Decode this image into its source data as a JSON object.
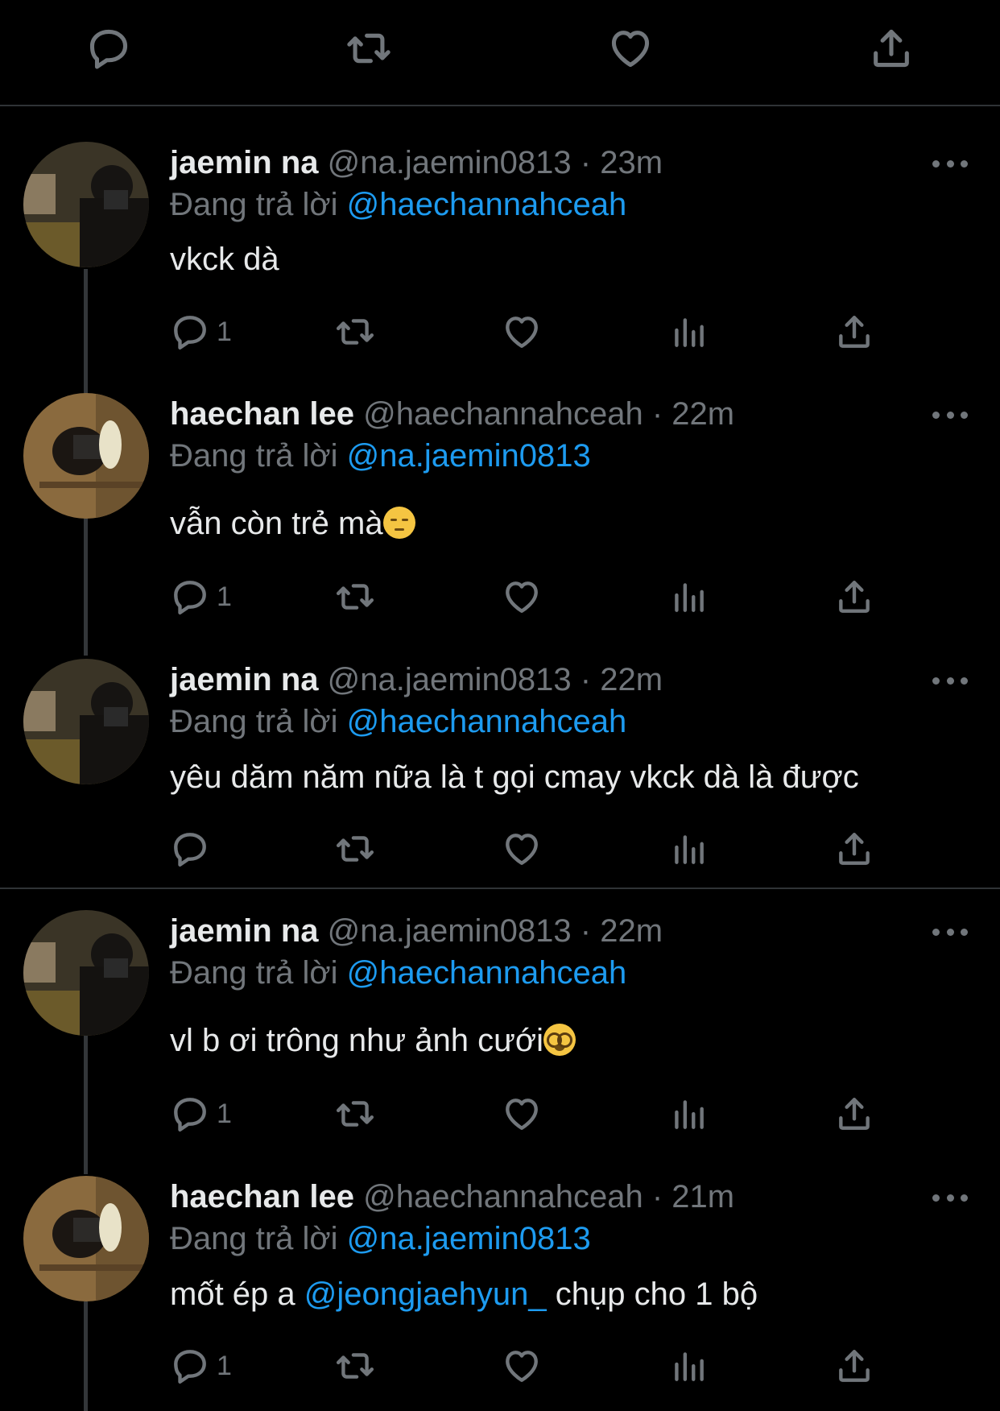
{
  "colors": {
    "background": "#000000",
    "text": "#e7e9ea",
    "muted": "#71767b",
    "accent": "#1d9bf0",
    "divider": "#2f3336"
  },
  "top_actions": [
    "reply-icon",
    "retweet-icon",
    "like-icon",
    "share-icon"
  ],
  "tweets": [
    {
      "name": "jaemin na",
      "handle": "@na.jaemin0813",
      "time": "· 23m",
      "replying_label": "Đang trả lời",
      "replying_to": "@haechannahceah",
      "text": "vkck dà",
      "reply_count": "1"
    },
    {
      "name": "haechan lee",
      "handle": "@haechannahceah",
      "time": "· 22m",
      "replying_label": "Đang trả lời",
      "replying_to": "@na.jaemin0813",
      "text": "vẫn còn trẻ mà",
      "emoji": "pensive-face",
      "reply_count": "1"
    },
    {
      "name": "jaemin na",
      "handle": "@na.jaemin0813",
      "time": "· 22m",
      "replying_label": "Đang trả lời",
      "replying_to": "@haechannahceah",
      "text": "yêu dăm năm nữa là t gọi cmay vkck dà là được",
      "reply_count": ""
    },
    {
      "name": "jaemin na",
      "handle": "@na.jaemin0813",
      "time": "· 22m",
      "replying_label": "Đang trả lời",
      "replying_to": "@haechannahceah",
      "text": "vl b ơi trông như ảnh cưới",
      "emoji": "nerd-face",
      "reply_count": "1"
    },
    {
      "name": "haechan lee",
      "handle": "@haechannahceah",
      "time": "· 21m",
      "replying_label": "Đang trả lời",
      "replying_to": "@na.jaemin0813",
      "text_before": "mốt ép a",
      "text_mention": "@jeongjaehyun_",
      "text_after": "chụp cho 1 bộ",
      "reply_count": "1"
    }
  ]
}
